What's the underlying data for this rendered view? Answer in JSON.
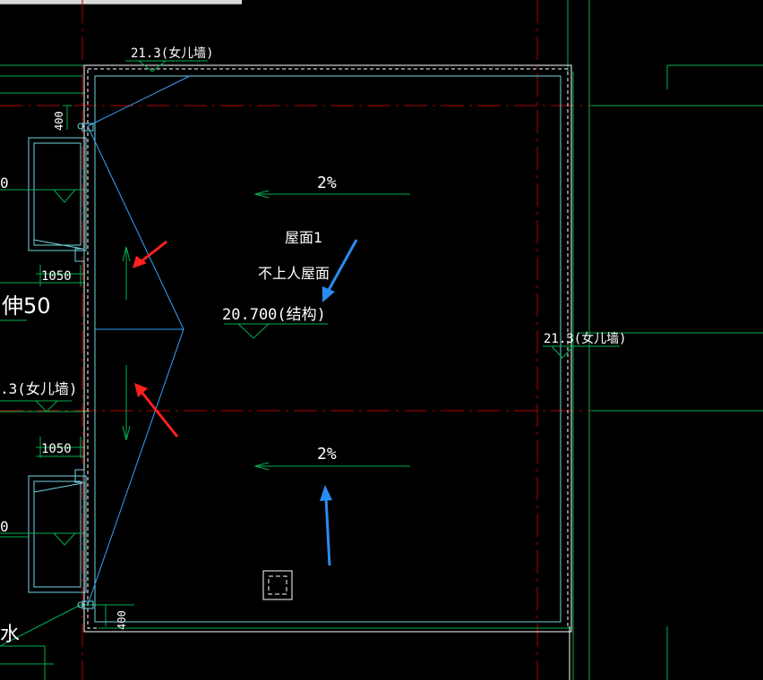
{
  "labels": {
    "top_parapet": "21.3(女儿墙)",
    "right_parapet": "21.3(女儿墙)",
    "left_parapet": ".3(女儿墙)",
    "slope_top": "2%",
    "slope_bottom": "2%",
    "roof_name": "屋面1",
    "roof_type": "不上人屋面",
    "elevation": "20.700(结构)",
    "dim_top_left": "1050",
    "dim_bottom_left": "1050",
    "dim_400_top": "400",
    "dim_400_bottom": "400",
    "left_fragment_1": "0",
    "left_fragment_2": "0",
    "left_fragment_ext": "伸50",
    "left_fragment_water": "水"
  },
  "colors": {
    "background": "#000000",
    "axis_red": "#b00000",
    "green": "#00b050",
    "cyan": "#6fd3e0",
    "blue": "#3aa0ff",
    "red_arrow": "#ff2020",
    "blue_arrow": "#2a8cf0",
    "white": "#ffffff"
  }
}
